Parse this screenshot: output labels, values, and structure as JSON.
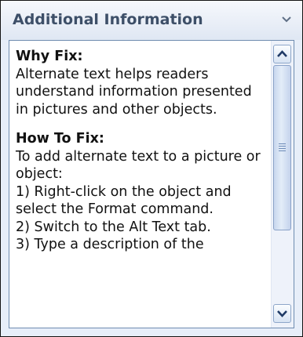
{
  "panel": {
    "title": "Additional Information",
    "collapse_icon": "chevron-down-icon"
  },
  "content": {
    "why_fix_heading": "Why Fix:",
    "why_fix_body": "Alternate text helps readers understand information presented in pictures and other objects.",
    "how_to_fix_heading": "How To Fix:",
    "how_to_fix_body": "To add alternate text to a picture or object:\n1) Right-click on the object and select the Format command.\n2) Switch to the Alt Text tab.\n3) Type a description of the"
  },
  "scrollbar": {
    "up_icon": "arrow-up-icon",
    "down_icon": "arrow-down-icon",
    "thumb_icon": "grip-icon"
  }
}
